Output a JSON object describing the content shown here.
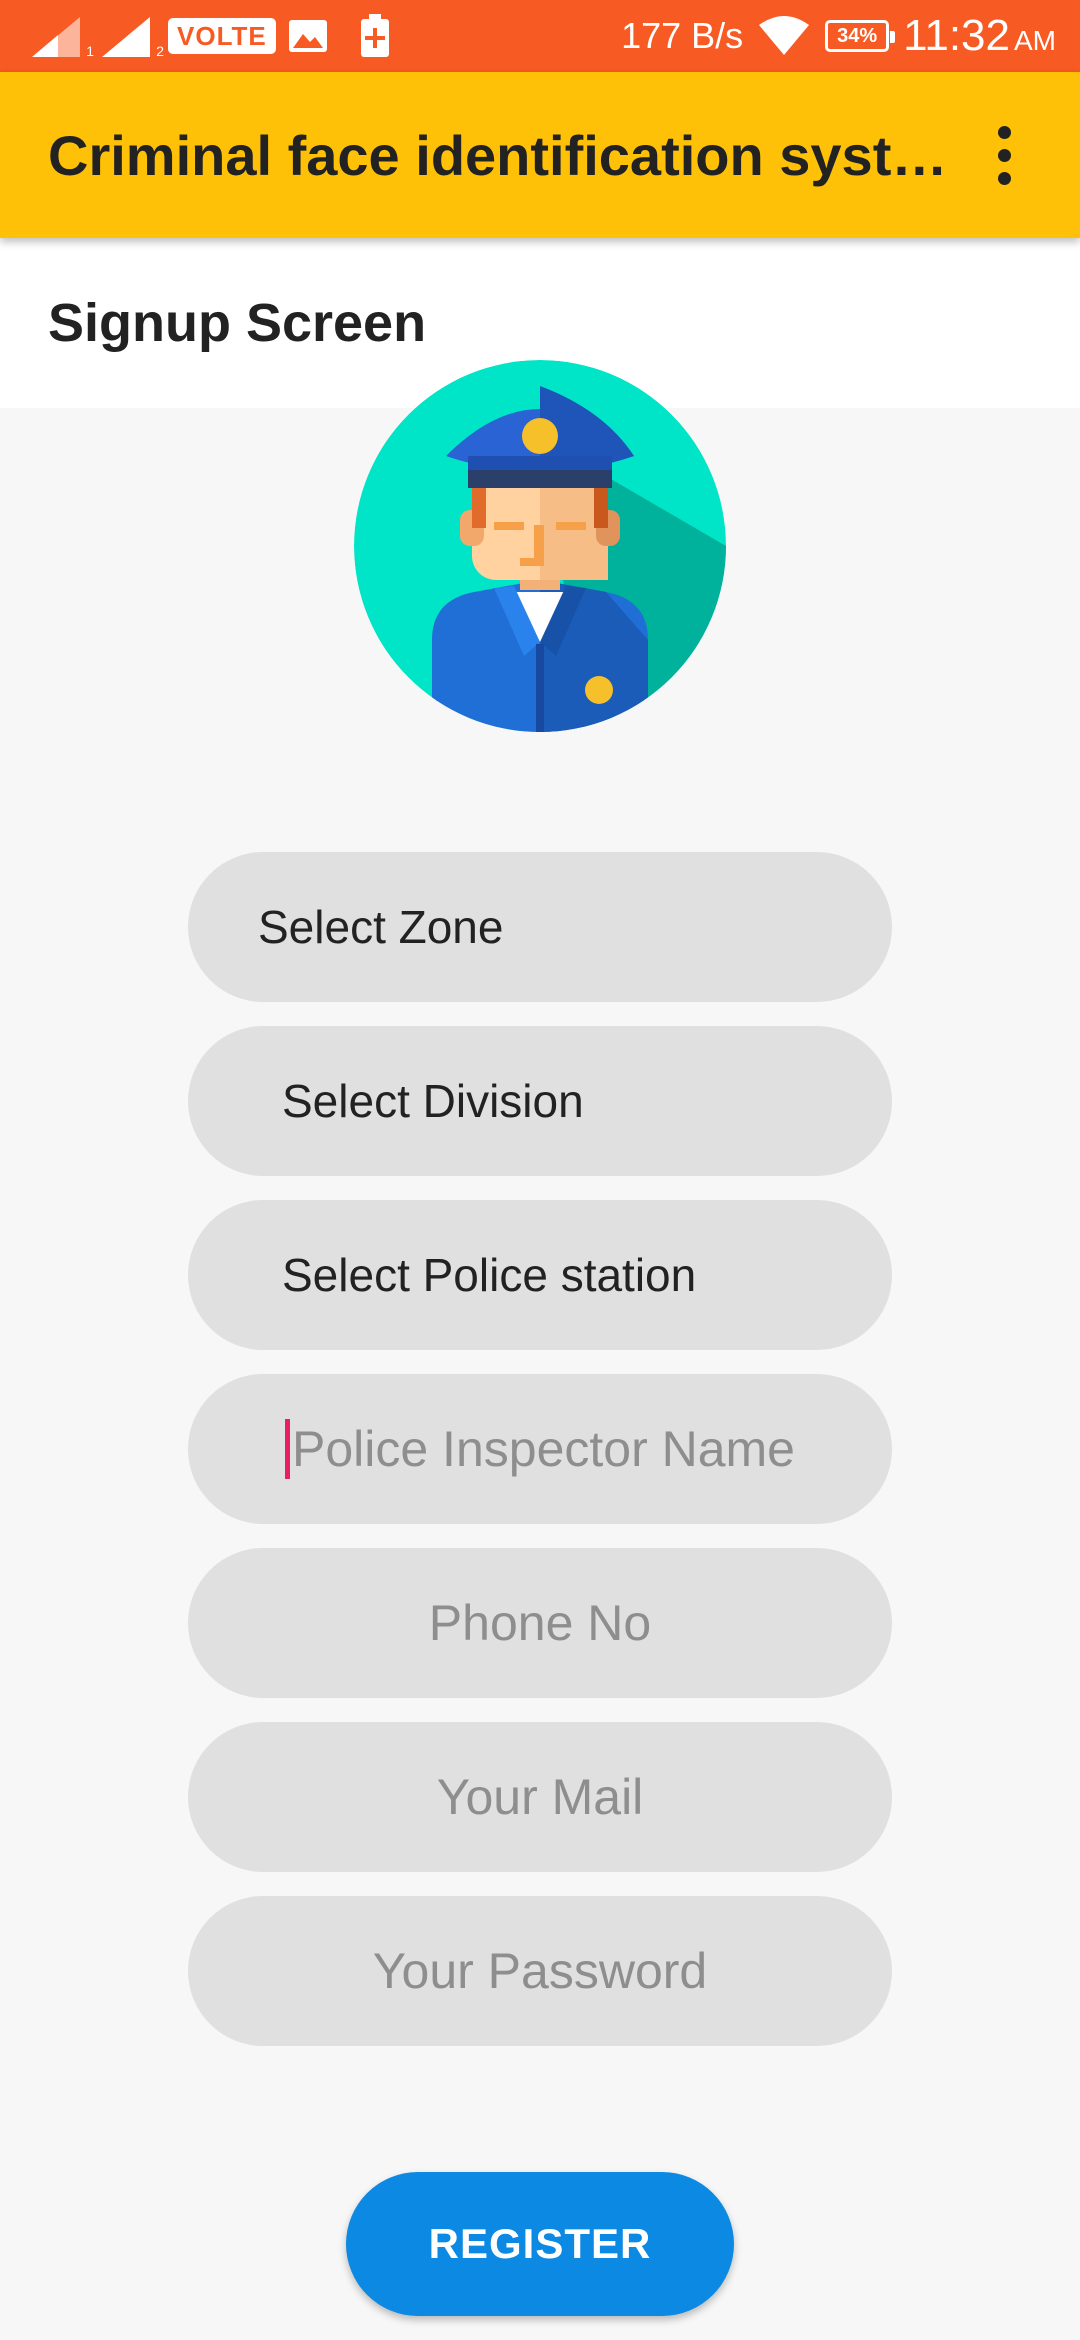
{
  "status_bar": {
    "sim1_label": "1",
    "sim2_label": "2",
    "volte": "VOLTE",
    "speed": "177 B/s",
    "battery": "34%",
    "time": "11:32",
    "ampm": "AM"
  },
  "app_bar": {
    "title": "Criminal face identification syst…",
    "menu_icon": "more-vert-icon"
  },
  "screen_title": "Signup Screen",
  "avatar": {
    "icon": "police-officer-avatar",
    "bg_color": "#00e5c7"
  },
  "form": {
    "zone_label": "Select Zone",
    "division_label": "Select Division",
    "station_label": "Select Police station",
    "inspector_placeholder": "Police Inspector Name",
    "phone_placeholder": "Phone No",
    "mail_placeholder": "Your Mail",
    "password_placeholder": "Your Password"
  },
  "register_label": "REGISTER",
  "colors": {
    "status_bar": "#f85a23",
    "app_bar": "#ffc107",
    "register": "#0b89e3",
    "field_bg": "#e0e0e0"
  }
}
